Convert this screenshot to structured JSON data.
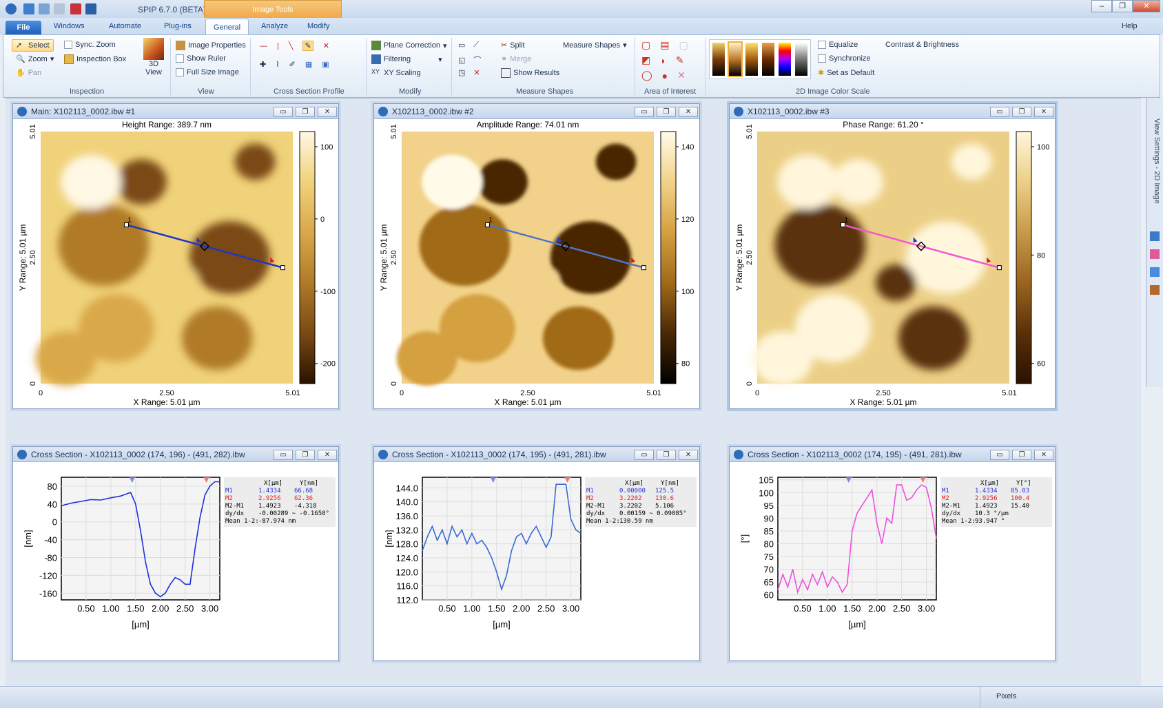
{
  "app": {
    "title": "SPIP 6.7.0 (BETA)",
    "context_tab": "Image Tools",
    "help": "Help"
  },
  "tabs": [
    "File",
    "Windows",
    "Automate",
    "Plug-ins",
    "General",
    "Analyze",
    "Modify"
  ],
  "ribbon": {
    "inspection": {
      "label": "Inspection",
      "select": "Select",
      "zoom": "Zoom",
      "pan": "Pan",
      "sync_zoom": "Sync. Zoom",
      "inspection_box": "Inspection Box",
      "view3d": "3D View"
    },
    "view": {
      "label": "View",
      "image_properties": "Image Properties",
      "show_ruler": "Show Ruler",
      "full_size": "Full Size Image"
    },
    "cross_section": {
      "label": "Cross Section Profile"
    },
    "modify": {
      "label": "Modify",
      "plane_correction": "Plane Correction",
      "filtering": "Filtering",
      "xy_scaling": "XY Scaling"
    },
    "measure": {
      "label": "Measure Shapes",
      "split": "Split",
      "merge": "Merge",
      "show_results": "Show Results",
      "measure_shapes": "Measure Shapes"
    },
    "aoi": {
      "label": "Area of Interest"
    },
    "colorscale": {
      "label": "2D Image Color Scale",
      "equalize": "Equalize",
      "synchronize": "Synchronize",
      "set_default": "Set as Default",
      "contrast": "Contrast & Brightness"
    }
  },
  "side_panel": "View Settings - 2D Image",
  "status": {
    "right": "Pixels"
  },
  "images": [
    {
      "title": "Main: X102113_0002.ibw #1",
      "range_label": "Height Range:  389.7 nm",
      "x_label": "X Range:  5.01 µm",
      "y_label": "Y Range:  5.01 µm",
      "x_ticks": [
        "0",
        "2.50",
        "5.01"
      ],
      "y_ticks": [
        "5.01",
        "2.50",
        "0"
      ],
      "cbar_ticks": [
        "100",
        "0",
        "-100",
        "-200"
      ],
      "line_color": "#1f35c8"
    },
    {
      "title": "X102113_0002.ibw #2",
      "range_label": "Amplitude Range:  74.01 nm",
      "x_label": "X Range:  5.01 µm",
      "y_label": "Y Range:  5.01 µm",
      "x_ticks": [
        "0",
        "2.50",
        "5.01"
      ],
      "y_ticks": [
        "5.01",
        "2.50",
        "0"
      ],
      "cbar_ticks": [
        "140",
        "120",
        "100",
        "80"
      ],
      "line_color": "#4f76c2"
    },
    {
      "title": "X102113_0002.ibw #3",
      "range_label": "Phase Range:  61.20 °",
      "x_label": "X Range:  5.01 µm",
      "y_label": "Y Range:  5.01 µm",
      "x_ticks": [
        "0",
        "2.50",
        "5.01"
      ],
      "y_ticks": [
        "5.01",
        "2.50",
        "0"
      ],
      "cbar_ticks": [
        "100",
        "80",
        "60"
      ],
      "line_color": "#f05ad0"
    }
  ],
  "sections": [
    {
      "title": "Cross Section - X102113_0002 (174, 196) - (491, 282).ibw",
      "ylabel": "[nm]",
      "xlabel": "[µm]",
      "color": "#1a2fe0",
      "table": [
        [
          "",
          "X[µm]",
          "Y[nm]"
        ],
        [
          "M1",
          "1.4334",
          "66.68"
        ],
        [
          "M2",
          "2.9256",
          "62.36"
        ],
        [
          "M2-M1",
          "1.4923",
          "-4.318"
        ],
        [
          "dy/dx",
          "-0.00289 ~ -0.1658°",
          ""
        ],
        [
          "Mean 1-2:",
          "-87.974 nm",
          ""
        ]
      ]
    },
    {
      "title": "Cross Section - X102113_0002 (174, 195) - (491, 281).ibw",
      "ylabel": "[nm]",
      "xlabel": "[µm]",
      "color": "#3a6ad4",
      "table": [
        [
          "",
          "X[µm]",
          "Y[nm]"
        ],
        [
          "M1",
          "0.00000",
          "125.5"
        ],
        [
          "M2",
          "3.2202",
          "130.6"
        ],
        [
          "M2-M1",
          "3.2202",
          "5.106"
        ],
        [
          "dy/dx",
          "0.00159 ~ 0.09085°",
          ""
        ],
        [
          "Mean 1-2:",
          "130.59 nm",
          ""
        ]
      ]
    },
    {
      "title": "Cross Section - X102113_0002 (174, 195) - (491, 281).ibw",
      "ylabel": "[°]",
      "xlabel": "[µm]",
      "color": "#f04ee0",
      "table": [
        [
          "",
          "X[µm]",
          "Y[°]"
        ],
        [
          "M1",
          "1.4334",
          "85.03"
        ],
        [
          "M2",
          "2.9256",
          "100.4"
        ],
        [
          "M2-M1",
          "1.4923",
          "15.40"
        ],
        [
          "dy/dx",
          "10.3 °/µm",
          ""
        ],
        [
          "Mean 1-2:",
          "93.947 °",
          ""
        ]
      ]
    }
  ],
  "chart_data": [
    {
      "type": "line",
      "xlabel": "[µm]",
      "ylabel": "[nm]",
      "xlim": [
        0,
        3.2
      ],
      "ylim": [
        -175,
        100
      ],
      "x_ticks": [
        0.5,
        1.0,
        1.5,
        2.0,
        2.5,
        3.0
      ],
      "y_ticks": [
        80,
        40,
        0,
        -40,
        -80,
        -120,
        -160
      ],
      "x": [
        0,
        0.2,
        0.4,
        0.6,
        0.8,
        1.0,
        1.2,
        1.4,
        1.5,
        1.6,
        1.7,
        1.8,
        1.9,
        2.0,
        2.1,
        2.2,
        2.3,
        2.4,
        2.5,
        2.6,
        2.7,
        2.8,
        2.9,
        3.0,
        3.1,
        3.2
      ],
      "y": [
        36,
        42,
        46,
        50,
        49,
        54,
        58,
        66,
        40,
        -20,
        -90,
        -140,
        -160,
        -168,
        -160,
        -140,
        -125,
        -130,
        -140,
        -140,
        -60,
        10,
        60,
        80,
        90,
        90
      ]
    },
    {
      "type": "line",
      "xlabel": "[µm]",
      "ylabel": "[nm]",
      "xlim": [
        0,
        3.2
      ],
      "ylim": [
        112,
        147
      ],
      "x_ticks": [
        0.5,
        1.0,
        1.5,
        2.0,
        2.5,
        3.0
      ],
      "y_ticks": [
        144.0,
        140.0,
        136.0,
        132.0,
        128.0,
        124.0,
        120.0,
        116.0,
        112.0
      ],
      "x": [
        0,
        0.1,
        0.2,
        0.3,
        0.4,
        0.5,
        0.6,
        0.7,
        0.8,
        0.9,
        1.0,
        1.1,
        1.2,
        1.3,
        1.4,
        1.5,
        1.6,
        1.7,
        1.8,
        1.9,
        2.0,
        2.1,
        2.2,
        2.3,
        2.4,
        2.5,
        2.6,
        2.7,
        2.8,
        2.9,
        3.0,
        3.1,
        3.2
      ],
      "y": [
        126,
        130,
        133,
        129,
        132,
        128,
        133,
        130,
        132,
        128,
        131,
        128,
        129,
        127,
        124,
        120,
        115,
        119,
        126,
        130,
        131,
        128,
        131,
        133,
        130,
        127,
        130,
        145,
        145,
        145,
        135,
        132,
        131
      ]
    },
    {
      "type": "line",
      "xlabel": "[µm]",
      "ylabel": "[°]",
      "xlim": [
        0,
        3.2
      ],
      "ylim": [
        58,
        106
      ],
      "x_ticks": [
        0.5,
        1.0,
        1.5,
        2.0,
        2.5,
        3.0
      ],
      "y_ticks": [
        105,
        100,
        95,
        90,
        85,
        80,
        75,
        70,
        65,
        60
      ],
      "x": [
        0,
        0.1,
        0.2,
        0.3,
        0.4,
        0.5,
        0.6,
        0.7,
        0.8,
        0.9,
        1.0,
        1.1,
        1.2,
        1.3,
        1.4,
        1.5,
        1.6,
        1.7,
        1.8,
        1.9,
        2.0,
        2.1,
        2.2,
        2.3,
        2.4,
        2.5,
        2.6,
        2.7,
        2.8,
        2.9,
        3.0,
        3.1,
        3.2
      ],
      "y": [
        62,
        68,
        63,
        70,
        61,
        66,
        62,
        68,
        64,
        69,
        63,
        67,
        65,
        61,
        64,
        85,
        92,
        95,
        98,
        101,
        88,
        80,
        90,
        88,
        103,
        103,
        97,
        98,
        101,
        103,
        102,
        94,
        82
      ]
    }
  ]
}
